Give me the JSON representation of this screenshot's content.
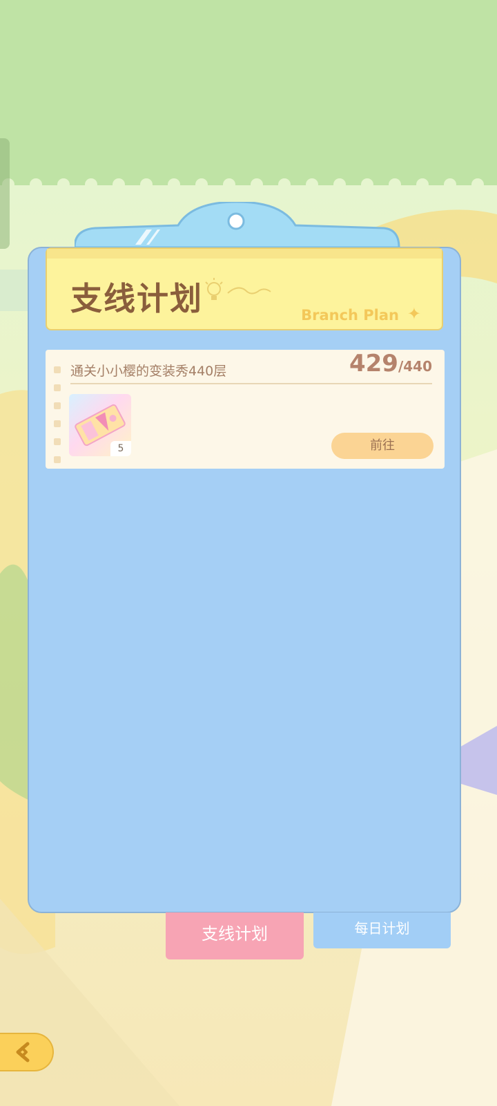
{
  "header": {
    "title": "支线计划",
    "subtitle": "Branch Plan"
  },
  "tasks": [
    {
      "description": "通关小小樱的变装秀440层",
      "progress_current": "429",
      "progress_total": "/440",
      "reward": {
        "icon": "ticket-icon",
        "count": "5"
      },
      "go_label": "前往"
    }
  ],
  "tabs": {
    "branch_label": "支线计划",
    "daily_label": "每日计划"
  },
  "navigation": {
    "back_icon": "back-arrow-icon"
  },
  "colors": {
    "board": "#a5cff5",
    "header": "#fdf39c",
    "active_tab": "#f7a4b4",
    "inactive_tab": "#a2cef6",
    "go_button": "#fbd494"
  }
}
